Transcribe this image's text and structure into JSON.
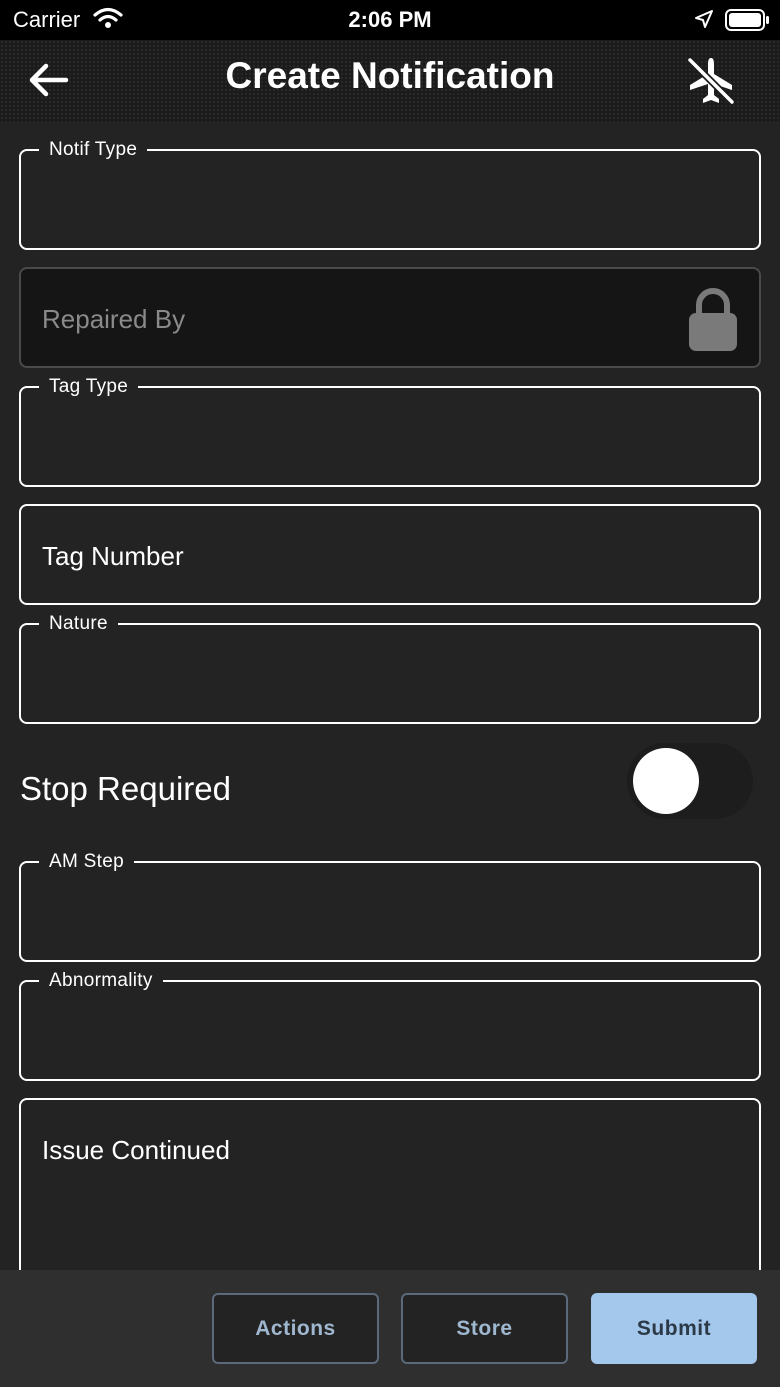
{
  "status_bar": {
    "carrier": "Carrier",
    "time": "2:06 PM"
  },
  "header": {
    "title": "Create Notification",
    "back_icon": "arrow-left-icon",
    "right_icon": "airplane-mode-off-icon"
  },
  "form": {
    "notif_type": {
      "label": "Notif Type",
      "value": ""
    },
    "repaired_by": {
      "placeholder": "Repaired By",
      "locked": true
    },
    "tag_type": {
      "label": "Tag Type",
      "value": ""
    },
    "tag_number": {
      "placeholder": "Tag Number"
    },
    "nature": {
      "label": "Nature",
      "value": ""
    },
    "stop_required": {
      "label": "Stop Required",
      "on": false
    },
    "am_step": {
      "label": "AM Step",
      "value": ""
    },
    "abnormality": {
      "label": "Abnormality",
      "value": ""
    },
    "issue_continued": {
      "placeholder": "Issue Continued"
    }
  },
  "footer": {
    "actions_label": "Actions",
    "store_label": "Store",
    "submit_label": "Submit"
  },
  "colors": {
    "background": "#232323",
    "accent": "#a3c8ec",
    "outline_button_text": "#9fb7cf"
  }
}
